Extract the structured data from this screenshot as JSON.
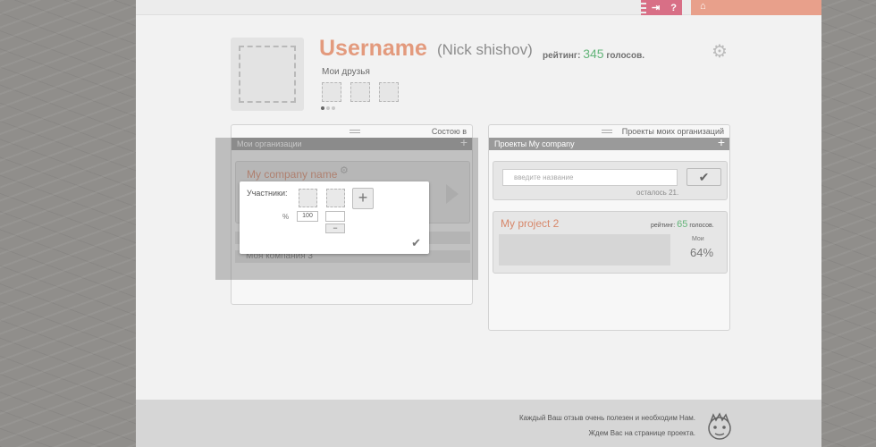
{
  "topbar": {
    "login_icon": "exit-icon",
    "help_label": "?",
    "home_icon": "home-icon"
  },
  "profile": {
    "username": "Username",
    "real_name": "(Nick shishov)",
    "rating_label": "рейтинг:",
    "rating_value": "345",
    "votes_label": "голосов.",
    "friends_title": "Мои друзья",
    "settings_icon": "gear-icon"
  },
  "orgs_panel": {
    "tab_label": "Состою в",
    "header": "Мои организации",
    "company_name": "My company name",
    "row_2": "...",
    "row_3": "Моя компания 3"
  },
  "popup": {
    "members_label": "Участники:",
    "add_label": "+",
    "percent_sign": "%",
    "share_value": "100",
    "minus_label": "−",
    "confirm_icon": "check-icon"
  },
  "projects_panel": {
    "tab_label": "Проекты моих организаций",
    "header": "Проекты My company",
    "search_placeholder": "введите название",
    "search_button_icon": "check-icon",
    "left_label": "осталось 21.",
    "project_name": "My project 2",
    "project_rating_label": "рейтинг:",
    "project_rating_value": "65",
    "project_votes_label": "голосов.",
    "project_mine_label": "Мои",
    "project_percent": "64%"
  },
  "footer": {
    "line1": "Каждый Ваш отзыв очень полезен и  необходим Нам.",
    "line2": "Ждем Вас на странице проекта.",
    "mascot_icon": "face-icon"
  }
}
